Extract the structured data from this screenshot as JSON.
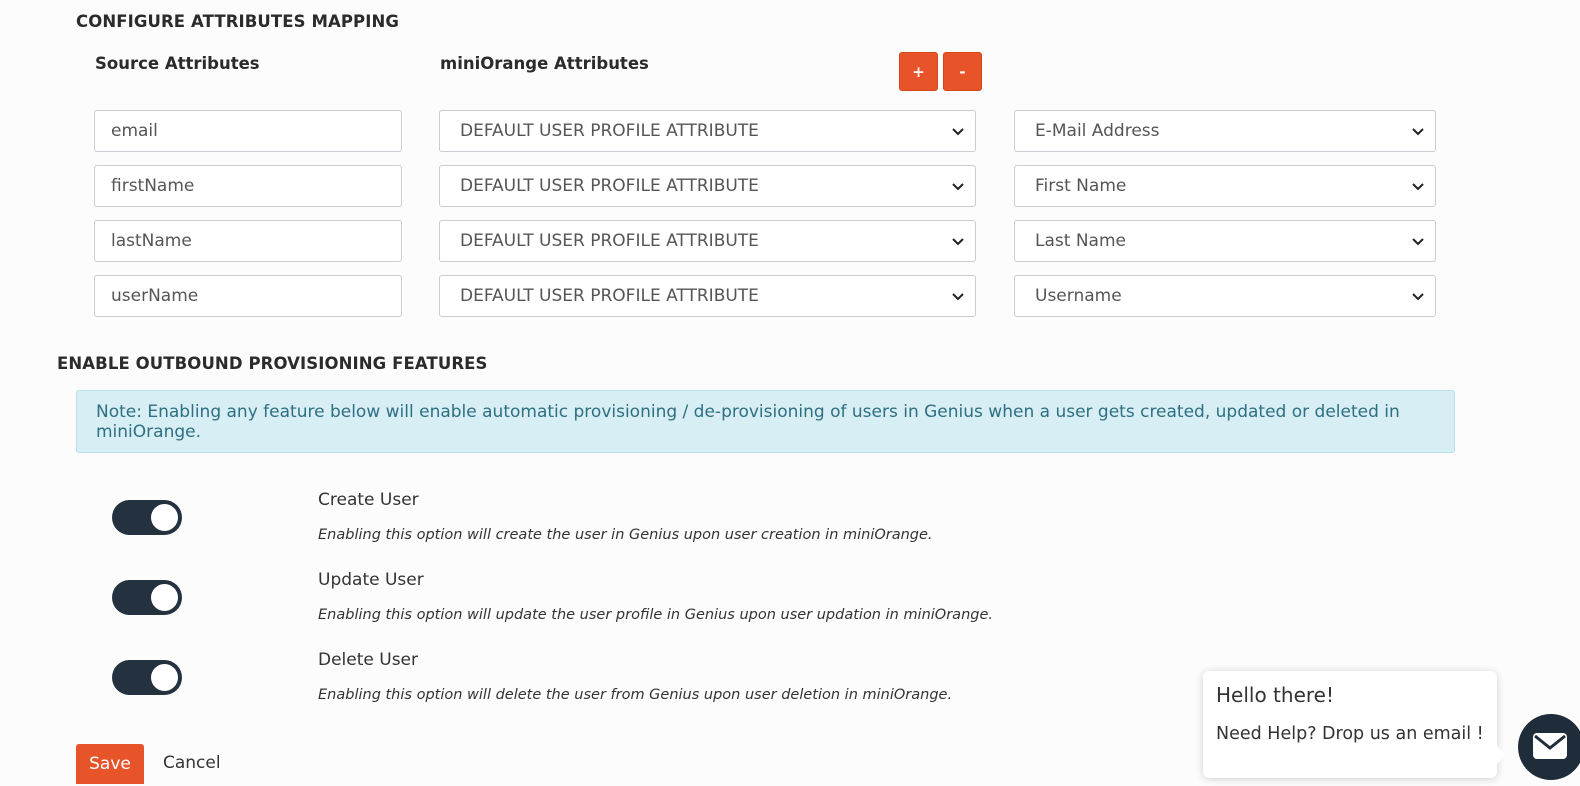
{
  "mapping": {
    "title": "CONFIGURE ATTRIBUTES MAPPING",
    "source_header": "Source Attributes",
    "target_header": "miniOrange Attributes",
    "add_label": "+",
    "remove_label": "-",
    "rows": [
      {
        "source": "email",
        "type": "DEFAULT USER PROFILE ATTRIBUTE",
        "attribute": "E-Mail Address"
      },
      {
        "source": "firstName",
        "type": "DEFAULT USER PROFILE ATTRIBUTE",
        "attribute": "First Name"
      },
      {
        "source": "lastName",
        "type": "DEFAULT USER PROFILE ATTRIBUTE",
        "attribute": "Last Name"
      },
      {
        "source": "userName",
        "type": "DEFAULT USER PROFILE ATTRIBUTE",
        "attribute": "Username"
      }
    ]
  },
  "provisioning": {
    "title": "ENABLE OUTBOUND PROVISIONING FEATURES",
    "note": "Note: Enabling any feature below will enable automatic provisioning / de-provisioning of users in Genius when a user gets created, updated or deleted in miniOrange.",
    "features": [
      {
        "title": "Create User",
        "description": "Enabling this option will create the user in Genius upon user creation in miniOrange.",
        "enabled": true
      },
      {
        "title": "Update User",
        "description": "Enabling this option will update the user profile in Genius upon user updation in miniOrange.",
        "enabled": true
      },
      {
        "title": "Delete User",
        "description": "Enabling this option will delete the user from Genius upon user deletion in miniOrange.",
        "enabled": true
      }
    ]
  },
  "actions": {
    "save_label": "Save",
    "cancel_label": "Cancel"
  },
  "chat": {
    "greeting": "Hello there!",
    "prompt": "Need Help? Drop us an email !",
    "launcher_icon": "envelope-icon"
  },
  "colors": {
    "accent": "#e8542a",
    "toggle_on": "#243240",
    "note_bg": "#d7eef5",
    "note_text": "#2e6f82"
  }
}
